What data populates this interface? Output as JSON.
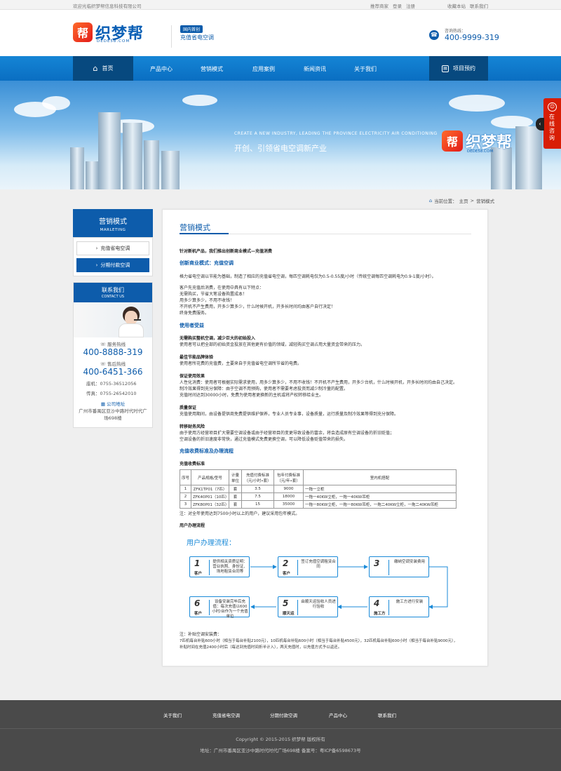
{
  "topbar": {
    "welcome": "欢迎光临织梦帮信息科技有限公司",
    "links": [
      "推荐商家",
      "登录",
      "注册",
      "收藏本站",
      "联系我们"
    ]
  },
  "header": {
    "logo_badge": "帮",
    "logo_name": "织梦帮",
    "logo_domain": "DEDE58.COM",
    "tag_pill": "国内首创",
    "tagline": "充值省电空调",
    "phone_label": "咨询热线：",
    "phone_number": "400-9999-319"
  },
  "nav": {
    "home": "首页",
    "items": [
      "产品中心",
      "营销模式",
      "应用案例",
      "新闻资讯",
      "关于我们"
    ],
    "appointment": "项目预约"
  },
  "banner": {
    "en": "CREATE A NEW INDUSTRY, LEADING THE PROVINCE ELECTRICITY AIR CONDITIONING",
    "cn": "开创、引领省电空调新产业",
    "logo_badge": "帮",
    "logo_name": "织梦帮",
    "logo_domain": "DEDE58.COM"
  },
  "side_consult": "在线咨询",
  "breadcrumb": [
    "当前位置：",
    "主页",
    ">",
    "营销模式"
  ],
  "sidebar": {
    "title": "营销模式",
    "title_en": "MARLETING",
    "items": [
      "充值省电空调",
      "分期付款空调"
    ],
    "contact_title": "联系我们",
    "contact_en": "CONTACT US",
    "service_label": "服务热线",
    "service_number": "400-8888-319",
    "aftersale_label": "售后热线",
    "aftersale_number": "400-6451-366",
    "phone_line": "座机：0755-36512056",
    "fax_line": "传真：0755-26542010",
    "address_label": "公司地址",
    "address": "广州市番禺区亚沙中路时代时代广场698楼"
  },
  "content": {
    "title": "营销模式",
    "intro": "针对新机产品，我们推出创新商业模式—充值消费",
    "h1": "创新商业模式：充值空调",
    "p1": "格力省电空调以节能为基础，制造了相应的充值省电空调，每匹空调耗电仅为0.5-0.55度/小时（传统空调每匹空调耗电为0.9-1度/小时）。",
    "p2": [
      "客户先充值后消费，在使用中具有以下特点：",
      "无需购买，节省大笔设备购置成本！",
      "用多少算多少，不用不收钱！",
      "不开机不产生费用，开多少算多少，什么时候开机，开多长时间均由客户自行决定！",
      "终身免费服务。"
    ],
    "h2": "使用者受益",
    "b1_t": "无需购买整机空调，减少巨大的初始投入",
    "b1": "使用者可以把全部的初始资金投放在其他更有价值的领域，减轻购买空调占用大量资金带来的压力。",
    "b2_t": "最佳节能品牌体验",
    "b2": "使用者所花费的充值费，主要来自于充值省电空调所节省的电费。",
    "b3_t": "保证使用效果",
    "b3": [
      "人性化消费：使用者可根据实际需求使用，用多少算多少，不用不收钱！不开机不产生费用，开多少台机，什么时候开机，开多长时间均由自己决定。",
      "制冷效果得到充分保障：由于空调不用预购，使用者不需要考虑投资而减少制冷量的配置。",
      "充值时间达到30000小时，免费为使用者更换新的主机或将产权转移给业主。"
    ],
    "b4_t": "质量保证",
    "b4": "充值使用期间，由设备提供商免费提供维护保养，专业人员专业事，设备质量，运行质量及制冷效果等得到充分保障。",
    "b5_t": "转移财务风险",
    "b5": [
      "由于使用方经营项目扩大需要空调设备或由于经营项目的变更导致设备的富余，将会造成原有空调设备的折旧贬值；",
      "空调设备的折旧速度非常快，通过充值模式免费更换空调，可以降低设备贬值带来的损失。"
    ],
    "h3": "充值收费标准及办理流程",
    "table_title": "充值收费标准",
    "table_header": [
      "序号",
      "产品规格/型号",
      "计量单位",
      "充值付费标准（元/小时•套）",
      "包年付费标准（元/年•套）",
      "室内机搭配"
    ],
    "table_rows": [
      [
        "1",
        "ZFK1TP01（7匹）",
        "套",
        "3.5",
        "9000",
        "一拖一立柜"
      ],
      [
        "2",
        "ZFK40P01（10匹）",
        "套",
        "7.5",
        "18000",
        "一拖一40KW立柜，一拖一40KW吊柜"
      ],
      [
        "3",
        "ZFK80P01（32匹）",
        "套",
        "15",
        "35000",
        "一拖一80KW立柜，一拖一80KW吊柜，一拖二40KW立柜，一拖二40KW吊柜"
      ]
    ],
    "table_note": "注：对全年使用达到7500小时以上的用户，建议采用包年模式。",
    "flow_heading": "用户办理流程",
    "flow_title": "用户办理流程：",
    "steps": [
      {
        "n": "1",
        "role": "客户",
        "desc": "提供相关资质证明：营业执照、身份证、场地租赁合同等"
      },
      {
        "n": "2",
        "role": "客户",
        "desc": "签订充值空调租赁合同"
      },
      {
        "n": "3",
        "role": "",
        "desc": "缴纳空调安装费用"
      },
      {
        "n": "4",
        "role": "施工方",
        "desc": "施工方进行安装"
      },
      {
        "n": "5",
        "role": "顺天运",
        "desc": "由顺天运验收人员进行验收"
      },
      {
        "n": "6",
        "role": "客户",
        "desc": "设备安装完毕后充值：每次充值以600小时/台作为一个充值单位"
      }
    ],
    "note_title": "注：补贴空调安装费：",
    "note_lines": [
      "7匹机每台补贴600小时（相当于每台补贴2100元），10匹机每台补贴600小时（相当于每台补贴4500元），32匹机每台补贴600小时（相当于每台补贴9000元），",
      "补贴时间在充值2400小时后（每达到充值时间折半计入），两天充值时，以充值方式予以返还。"
    ]
  },
  "footer": {
    "nav": [
      "关于我们",
      "充值省电空调",
      "分期付款空调",
      "产品中心",
      "联系我们"
    ],
    "copyright": "Copyright © 2015-2015 织梦帮 版权所有",
    "address": "地址：广州市番禺区亚沙中路时代时代广场698楼     备案号：粤ICP备6598673号"
  },
  "colors": {
    "primary": "#0d5cab",
    "nav": "#1585d5",
    "accent_red": "#d81e06",
    "footer": "#4a4a4a"
  }
}
